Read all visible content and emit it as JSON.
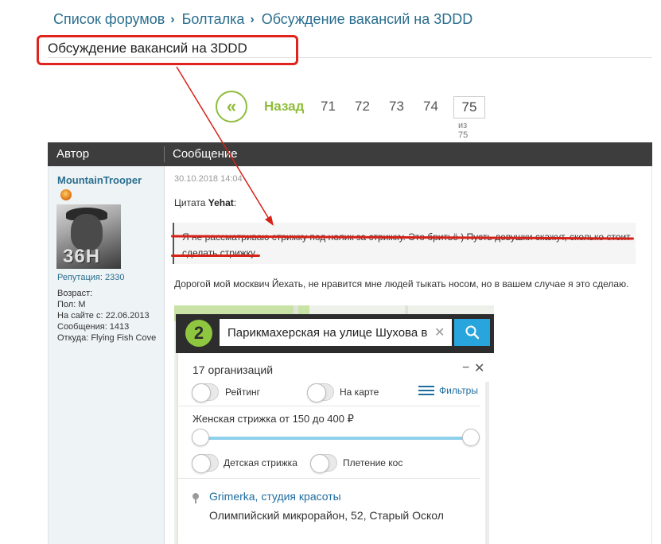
{
  "breadcrumb": {
    "items": [
      "Список форумов",
      "Болталка",
      "Обсуждение вакансий на 3DDD"
    ],
    "separator": "›"
  },
  "page_title": "Обсуждение вакансий на 3DDD",
  "pagination": {
    "back_label": "Назад",
    "back_icon": "double-chevron-left-icon",
    "pages": [
      "71",
      "72",
      "73",
      "74"
    ],
    "current": "75",
    "of_label": "из 75"
  },
  "table_header": {
    "author": "Автор",
    "message": "Сообщение"
  },
  "author": {
    "name": "MountainTrooper",
    "avatar_text": "36H",
    "reputation": "Репутация: 2330",
    "info": [
      "Возраст:",
      "Пол: М",
      "На сайте с: 22.06.2013",
      "Сообщения: 1413",
      "Откуда: Flying Fish Cove"
    ]
  },
  "post": {
    "date": "30.10.2018 14:04",
    "quote_prefix": "Цитата",
    "quote_author": "Yehat",
    "quote_suffix": ":",
    "quote_text": "Я не рассматриваю стрижку под нолик за стрижку. Это бритьё ) Пусть девушки скажут, сколько стоит сделать стрижку.",
    "body": "Дорогой мой москвич Йехать, не нравится мне людей тыкать носом, но в вашем случае я это сделаю."
  },
  "map_app": {
    "logo_text": "2",
    "search_value": "Парикмахерская на улице Шухова в Ст",
    "clear_icon": "close-icon",
    "search_icon": "search-icon",
    "results_count": "17 организаций",
    "minimize": "−",
    "close": "✕",
    "toggles": [
      "Рейтинг",
      "На карте",
      "Детская стрижка",
      "Плетение кос"
    ],
    "filters_label": "Фильтры",
    "price_label": "Женская стрижка от 150 до 400 ₽",
    "org_name": "Grimerka, студия красоты",
    "org_address": "Олимпийский микрорайон, 52, Старый Оскол"
  },
  "colors": {
    "link": "#2a6e8f",
    "accent_green": "#8fbc3b",
    "highlight_red": "#e0231c",
    "header_bg": "#3d3d3d",
    "search_blue": "#28a5dd"
  }
}
